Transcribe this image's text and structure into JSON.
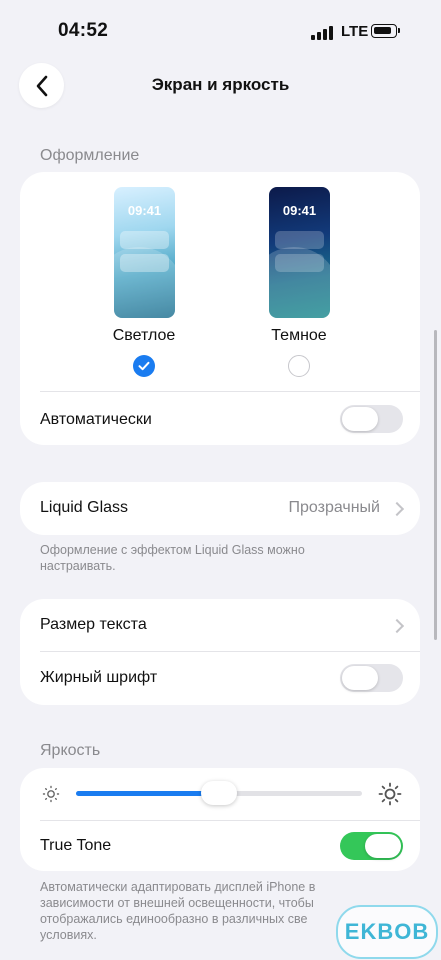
{
  "status_bar": {
    "time": "04:52",
    "network": "LTE"
  },
  "nav": {
    "title": "Экран и яркость"
  },
  "appearance": {
    "header": "Оформление",
    "preview_time": "09:41",
    "light_label": "Светлое",
    "dark_label": "Темное",
    "selected": "light",
    "auto_label": "Автоматически",
    "auto_enabled": false
  },
  "liquid_glass": {
    "label": "Liquid Glass",
    "value": "Прозрачный",
    "footnote": "Оформление с эффектом Liquid Glass можно настраивать."
  },
  "text": {
    "size_label": "Размер текста",
    "bold_label": "Жирный шрифт",
    "bold_enabled": false
  },
  "brightness": {
    "header": "Яркость",
    "level": 0.5,
    "true_tone_label": "True Tone",
    "true_tone_enabled": true,
    "footnote": "Автоматически адаптировать дисплей iPhone в зависимости от внешней освещенности, чтобы отображались единообразно в различных све условиях."
  },
  "watermark": "EKBOB",
  "colors": {
    "accent": "#1a7cf0",
    "toggle_on": "#34c759",
    "background": "#f2f2f7"
  }
}
